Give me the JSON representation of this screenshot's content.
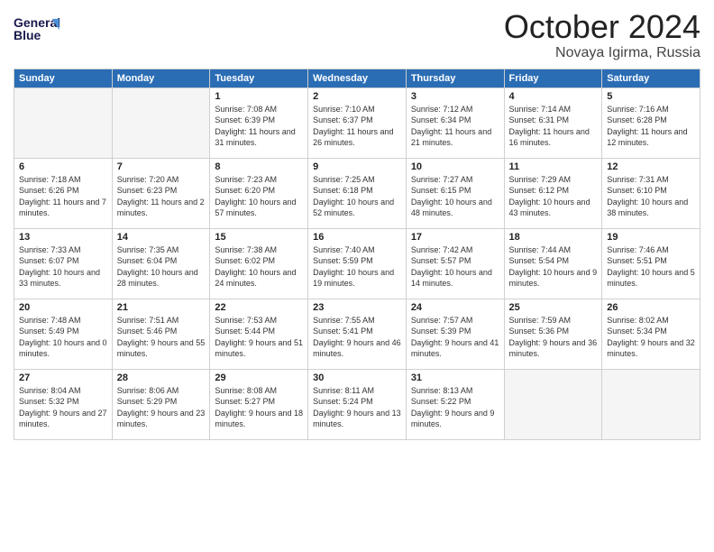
{
  "header": {
    "logo_line1": "General",
    "logo_line2": "Blue",
    "month": "October 2024",
    "location": "Novaya Igirma, Russia"
  },
  "weekdays": [
    "Sunday",
    "Monday",
    "Tuesday",
    "Wednesday",
    "Thursday",
    "Friday",
    "Saturday"
  ],
  "weeks": [
    [
      {
        "day": "",
        "info": ""
      },
      {
        "day": "",
        "info": ""
      },
      {
        "day": "1",
        "info": "Sunrise: 7:08 AM\nSunset: 6:39 PM\nDaylight: 11 hours and 31 minutes."
      },
      {
        "day": "2",
        "info": "Sunrise: 7:10 AM\nSunset: 6:37 PM\nDaylight: 11 hours and 26 minutes."
      },
      {
        "day": "3",
        "info": "Sunrise: 7:12 AM\nSunset: 6:34 PM\nDaylight: 11 hours and 21 minutes."
      },
      {
        "day": "4",
        "info": "Sunrise: 7:14 AM\nSunset: 6:31 PM\nDaylight: 11 hours and 16 minutes."
      },
      {
        "day": "5",
        "info": "Sunrise: 7:16 AM\nSunset: 6:28 PM\nDaylight: 11 hours and 12 minutes."
      }
    ],
    [
      {
        "day": "6",
        "info": "Sunrise: 7:18 AM\nSunset: 6:26 PM\nDaylight: 11 hours and 7 minutes."
      },
      {
        "day": "7",
        "info": "Sunrise: 7:20 AM\nSunset: 6:23 PM\nDaylight: 11 hours and 2 minutes."
      },
      {
        "day": "8",
        "info": "Sunrise: 7:23 AM\nSunset: 6:20 PM\nDaylight: 10 hours and 57 minutes."
      },
      {
        "day": "9",
        "info": "Sunrise: 7:25 AM\nSunset: 6:18 PM\nDaylight: 10 hours and 52 minutes."
      },
      {
        "day": "10",
        "info": "Sunrise: 7:27 AM\nSunset: 6:15 PM\nDaylight: 10 hours and 48 minutes."
      },
      {
        "day": "11",
        "info": "Sunrise: 7:29 AM\nSunset: 6:12 PM\nDaylight: 10 hours and 43 minutes."
      },
      {
        "day": "12",
        "info": "Sunrise: 7:31 AM\nSunset: 6:10 PM\nDaylight: 10 hours and 38 minutes."
      }
    ],
    [
      {
        "day": "13",
        "info": "Sunrise: 7:33 AM\nSunset: 6:07 PM\nDaylight: 10 hours and 33 minutes."
      },
      {
        "day": "14",
        "info": "Sunrise: 7:35 AM\nSunset: 6:04 PM\nDaylight: 10 hours and 28 minutes."
      },
      {
        "day": "15",
        "info": "Sunrise: 7:38 AM\nSunset: 6:02 PM\nDaylight: 10 hours and 24 minutes."
      },
      {
        "day": "16",
        "info": "Sunrise: 7:40 AM\nSunset: 5:59 PM\nDaylight: 10 hours and 19 minutes."
      },
      {
        "day": "17",
        "info": "Sunrise: 7:42 AM\nSunset: 5:57 PM\nDaylight: 10 hours and 14 minutes."
      },
      {
        "day": "18",
        "info": "Sunrise: 7:44 AM\nSunset: 5:54 PM\nDaylight: 10 hours and 9 minutes."
      },
      {
        "day": "19",
        "info": "Sunrise: 7:46 AM\nSunset: 5:51 PM\nDaylight: 10 hours and 5 minutes."
      }
    ],
    [
      {
        "day": "20",
        "info": "Sunrise: 7:48 AM\nSunset: 5:49 PM\nDaylight: 10 hours and 0 minutes."
      },
      {
        "day": "21",
        "info": "Sunrise: 7:51 AM\nSunset: 5:46 PM\nDaylight: 9 hours and 55 minutes."
      },
      {
        "day": "22",
        "info": "Sunrise: 7:53 AM\nSunset: 5:44 PM\nDaylight: 9 hours and 51 minutes."
      },
      {
        "day": "23",
        "info": "Sunrise: 7:55 AM\nSunset: 5:41 PM\nDaylight: 9 hours and 46 minutes."
      },
      {
        "day": "24",
        "info": "Sunrise: 7:57 AM\nSunset: 5:39 PM\nDaylight: 9 hours and 41 minutes."
      },
      {
        "day": "25",
        "info": "Sunrise: 7:59 AM\nSunset: 5:36 PM\nDaylight: 9 hours and 36 minutes."
      },
      {
        "day": "26",
        "info": "Sunrise: 8:02 AM\nSunset: 5:34 PM\nDaylight: 9 hours and 32 minutes."
      }
    ],
    [
      {
        "day": "27",
        "info": "Sunrise: 8:04 AM\nSunset: 5:32 PM\nDaylight: 9 hours and 27 minutes."
      },
      {
        "day": "28",
        "info": "Sunrise: 8:06 AM\nSunset: 5:29 PM\nDaylight: 9 hours and 23 minutes."
      },
      {
        "day": "29",
        "info": "Sunrise: 8:08 AM\nSunset: 5:27 PM\nDaylight: 9 hours and 18 minutes."
      },
      {
        "day": "30",
        "info": "Sunrise: 8:11 AM\nSunset: 5:24 PM\nDaylight: 9 hours and 13 minutes."
      },
      {
        "day": "31",
        "info": "Sunrise: 8:13 AM\nSunset: 5:22 PM\nDaylight: 9 hours and 9 minutes."
      },
      {
        "day": "",
        "info": ""
      },
      {
        "day": "",
        "info": ""
      }
    ]
  ]
}
